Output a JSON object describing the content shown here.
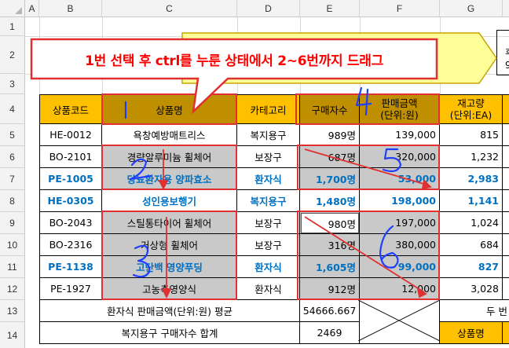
{
  "columns": [
    "A",
    "B",
    "C",
    "D",
    "E",
    "F",
    "G"
  ],
  "rows": [
    "1",
    "2",
    "3",
    "4",
    "5",
    "6",
    "7",
    "8",
    "9",
    "10",
    "11",
    "12",
    "13",
    "14"
  ],
  "instruction": "1번 선택 후 ctrl를 누룬 상태에서 2~6번까지 드래그",
  "edge_fragments": [
    "후",
    "9"
  ],
  "header": {
    "code": "상품코드",
    "name": "상품명",
    "category": "카테고리",
    "buyers": "구매자수",
    "amount_line1": "판매금액",
    "amount_line2": "(단위:원)",
    "stock_line1": "재고량",
    "stock_line2": "(단위:EA)"
  },
  "table_rows": [
    {
      "code": "HE-0012",
      "name": "욕창예방매트리스",
      "category": "복지용구",
      "buyers": "989명",
      "amount": "139,000",
      "stock": "815",
      "highlight": false
    },
    {
      "code": "BO-2101",
      "name": "경량알루미늄 휠체어",
      "category": "보장구",
      "buyers": "687명",
      "amount": "320,000",
      "stock": "1,232",
      "highlight": false
    },
    {
      "code": "PE-1005",
      "name": "당뇨환자용 양파효소",
      "category": "환자식",
      "buyers": "1,700명",
      "amount": "53,000",
      "stock": "2,983",
      "highlight": true
    },
    {
      "code": "HE-0305",
      "name": "성인용보행기",
      "category": "복지용구",
      "buyers": "1,480명",
      "amount": "198,000",
      "stock": "1,141",
      "highlight": true
    },
    {
      "code": "BO-2043",
      "name": "스틸통타이어 휠체어",
      "category": "보장구",
      "buyers": "980명",
      "amount": "197,000",
      "stock": "1,024",
      "highlight": false
    },
    {
      "code": "BO-2316",
      "name": "거상형 휠체어",
      "category": "보장구",
      "buyers": "316명",
      "amount": "380,000",
      "stock": "684",
      "highlight": false
    },
    {
      "code": "PE-1138",
      "name": "고단백 영양푸딩",
      "category": "환자식",
      "buyers": "1,605명",
      "amount": "99,000",
      "stock": "827",
      "highlight": true
    },
    {
      "code": "PE-1927",
      "name": "고농축영양식",
      "category": "환자식",
      "buyers": "912명",
      "amount": "12,000",
      "stock": "3,028",
      "highlight": false
    }
  ],
  "summary": {
    "avg_label": "환자식 판매금액(단위:원) 평균",
    "avg_value": "54666.667",
    "sum_label": "복지용구 구매자수 합계",
    "sum_value": "2469",
    "right_fragment": "두 번",
    "product_name_label": "상품명"
  },
  "annotations": [
    "1",
    "2",
    "3",
    "4",
    "5",
    "6"
  ],
  "colors": {
    "header_orange": "#ffc000",
    "header_dark": "#bf8f00",
    "selected_gray": "#c9c9c9",
    "accent_blue": "#0070c0",
    "annotation_red": "#e03030",
    "annotation_blue": "#1f3fff",
    "callout_fill": "#ffff99"
  }
}
